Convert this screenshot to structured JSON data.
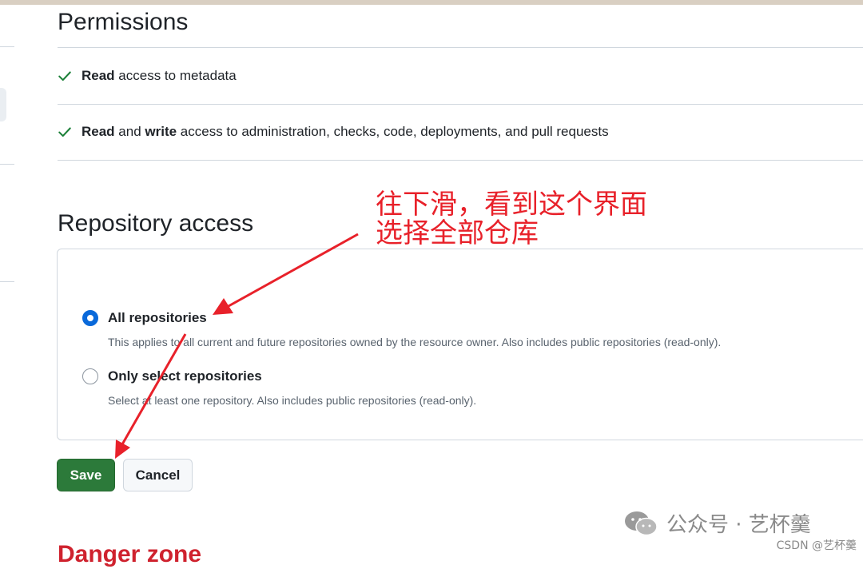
{
  "permissions": {
    "title": "Permissions",
    "items": [
      {
        "strong": "Read",
        "text": " access to metadata"
      },
      {
        "strong": "Read",
        "mid": " and ",
        "strong2": "write",
        "text": " access to administration, checks, code, deployments, and pull requests"
      }
    ]
  },
  "repository_access": {
    "title": "Repository access",
    "options": [
      {
        "label": "All repositories",
        "description": "This applies to all current and future repositories owned by the resource owner. Also includes public repositories (read-only).",
        "selected": true
      },
      {
        "label": "Only select repositories",
        "description": "Select at least one repository. Also includes public repositories (read-only).",
        "selected": false
      }
    ]
  },
  "actions": {
    "save_label": "Save",
    "cancel_label": "Cancel"
  },
  "danger_zone": {
    "title": "Danger zone"
  },
  "annotation": {
    "line1": "往下滑，看到这个界面",
    "line2": "选择全部仓库"
  },
  "watermark": {
    "text": "公众号 · 艺杯羹",
    "credit": "CSDN @艺杯羹"
  },
  "colors": {
    "primary_button": "#2c7a3a",
    "radio_selected": "#0969da",
    "annotation": "#e8212a",
    "danger": "#cf222e",
    "check": "#1a7f37"
  }
}
